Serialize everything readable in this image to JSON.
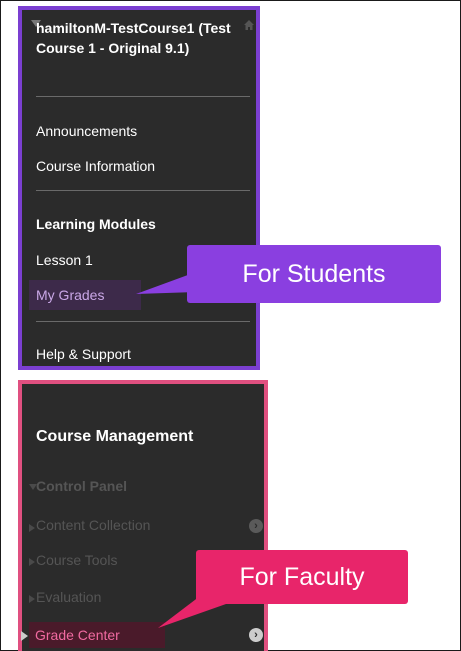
{
  "course_menu": {
    "course_title": "hamiltonM-TestCourse1 (Test Course 1 - Original 9.1)",
    "items": {
      "announcements": "Announcements",
      "course_information": "Course Information",
      "learning_modules": "Learning Modules",
      "lesson_1": "Lesson 1",
      "my_grades": "My Grades",
      "help_support": "Help & Support"
    }
  },
  "management": {
    "heading": "Course Management",
    "control_panel": "Control Panel",
    "items": {
      "content_collection": "Content Collection",
      "course_tools": "Course Tools",
      "evaluation": "Evaluation",
      "grade_center": "Grade Center"
    }
  },
  "callouts": {
    "students": "For Students",
    "faculty": "For Faculty"
  },
  "colors": {
    "menu_bg": "#2b2b2b",
    "students_accent": "#7b3fd1",
    "faculty_accent": "#e05080",
    "students_callout": "#8a3fe0",
    "faculty_callout": "#e8256a"
  }
}
